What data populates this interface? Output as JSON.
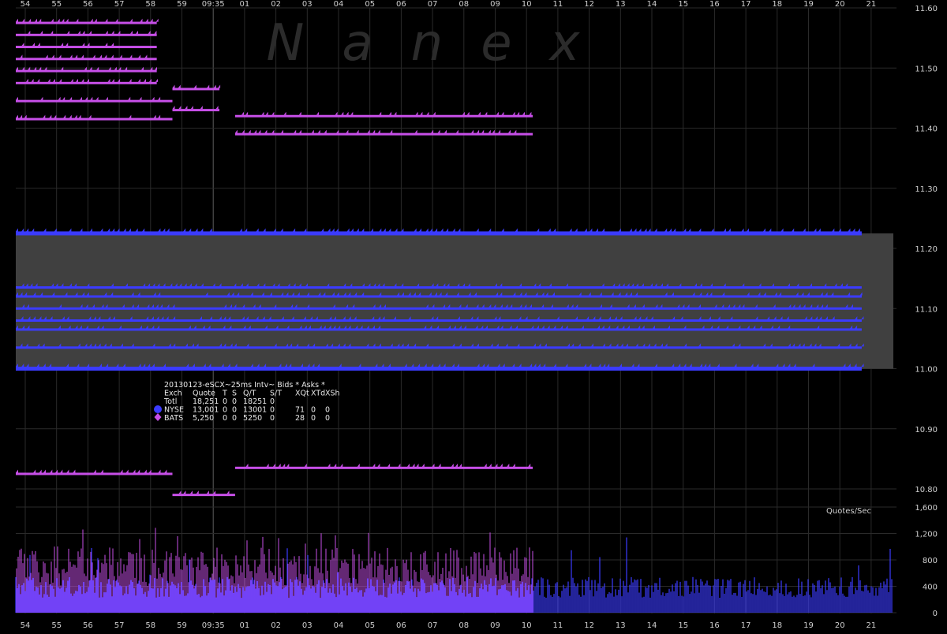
{
  "watermark": "Nanex",
  "x_axis": {
    "ticks": [
      "54",
      "55",
      "56",
      "57",
      "58",
      "59",
      "09:35",
      "01",
      "02",
      "03",
      "04",
      "05",
      "06",
      "07",
      "08",
      "09",
      "10",
      "11",
      "12",
      "13",
      "14",
      "15",
      "16",
      "17",
      "18",
      "19",
      "20",
      "21"
    ]
  },
  "price_axis": {
    "ticks": [
      "11.60",
      "11.50",
      "11.40",
      "11.30",
      "11.20",
      "11.10",
      "11.00",
      "10.90",
      "10.80"
    ]
  },
  "rate_axis": {
    "ticks": [
      "1,600",
      "1,200",
      "800",
      "400",
      "0"
    ],
    "label": "Quotes/Sec"
  },
  "legend": {
    "title": "20130123-eSCX~25ms Intv~ Bids * Asks *",
    "header": [
      "Exch",
      "Quote",
      "T",
      "S",
      "Q/T",
      "S/T",
      "XQt",
      "XTd",
      "XSh"
    ],
    "rows": [
      {
        "exch": "Totl",
        "quote": "18,251",
        "t": "0",
        "s": "0",
        "qt": "18251",
        "st": "0",
        "xqt": "",
        "xtd": "",
        "xsh": ""
      },
      {
        "exch": "NYSE",
        "quote": "13,001",
        "t": "0",
        "s": "0",
        "qt": "13001",
        "st": "0",
        "xqt": "71",
        "xtd": "0",
        "xsh": "0",
        "marker": "circle",
        "color": "#3b3bff"
      },
      {
        "exch": "BATS",
        "quote": "5,250",
        "t": "0",
        "s": "0",
        "qt": "5250",
        "st": "0",
        "xqt": "28",
        "xtd": "0",
        "xsh": "0",
        "marker": "diamond",
        "color": "#c74fe8"
      }
    ]
  },
  "colors": {
    "background": "#000000",
    "grid": "#2a2a2a",
    "nyse": "#3b3bff",
    "bats": "#c74fe8",
    "spread_fill": "#404040",
    "axis_text": "#cfcfcf"
  },
  "chart_data": [
    {
      "type": "scatter",
      "title": "20130123-eSCX~25ms Intv~ Bids * Asks *",
      "xlabel": "",
      "ylabel": "",
      "x_ticks": [
        "54",
        "55",
        "56",
        "57",
        "58",
        "59",
        "09:35",
        "01",
        "02",
        "03",
        "04",
        "05",
        "06",
        "07",
        "08",
        "09",
        "10",
        "11",
        "12",
        "13",
        "14",
        "15",
        "16",
        "17",
        "18",
        "19",
        "20",
        "21"
      ],
      "ylim": [
        10.78,
        11.6
      ],
      "grid": true,
      "legend_position": "center-left",
      "series": [
        {
          "name": "NYSE",
          "levels": [
            {
              "price": 11.225,
              "x": [
                "54",
                "21"
              ]
            },
            {
              "price": 11.135,
              "x": [
                "54",
                "21"
              ]
            },
            {
              "price": 11.12,
              "x": [
                "54",
                "21"
              ]
            },
            {
              "price": 11.1,
              "x": [
                "54",
                "21"
              ]
            },
            {
              "price": 11.08,
              "x": [
                "54",
                "21"
              ]
            },
            {
              "price": 11.065,
              "x": [
                "54",
                "21"
              ]
            },
            {
              "price": 11.035,
              "x": [
                "54",
                "21"
              ]
            },
            {
              "price": 11.0,
              "x": [
                "54",
                "21"
              ]
            }
          ]
        },
        {
          "name": "BATS",
          "levels": [
            {
              "price": 11.575,
              "x": [
                "54",
                "58.5"
              ]
            },
            {
              "price": 11.555,
              "x": [
                "54",
                "58.5"
              ]
            },
            {
              "price": 11.535,
              "x": [
                "54",
                "58.5"
              ]
            },
            {
              "price": 11.515,
              "x": [
                "54",
                "58.5"
              ]
            },
            {
              "price": 11.495,
              "x": [
                "54",
                "58.5"
              ]
            },
            {
              "price": 11.475,
              "x": [
                "54",
                "58.5"
              ]
            },
            {
              "price": 11.445,
              "x": [
                "54",
                "59"
              ]
            },
            {
              "price": 11.415,
              "x": [
                "54",
                "59"
              ]
            },
            {
              "price": 11.465,
              "x": [
                "59",
                "09:35.5"
              ]
            },
            {
              "price": 11.43,
              "x": [
                "59",
                "09:35.5"
              ]
            },
            {
              "price": 11.42,
              "x": [
                "01",
                "10.5"
              ]
            },
            {
              "price": 11.39,
              "x": [
                "01",
                "10.5"
              ]
            },
            {
              "price": 10.825,
              "x": [
                "54",
                "59"
              ]
            },
            {
              "price": 10.79,
              "x": [
                "59",
                "01"
              ]
            },
            {
              "price": 10.835,
              "x": [
                "01",
                "10.5"
              ]
            }
          ]
        }
      ]
    },
    {
      "type": "bar",
      "title": "",
      "ylabel": "Quotes/Sec",
      "ylim": [
        0,
        1600
      ],
      "x_ticks": [
        "54",
        "55",
        "56",
        "57",
        "58",
        "59",
        "09:35",
        "01",
        "02",
        "03",
        "04",
        "05",
        "06",
        "07",
        "08",
        "09",
        "10",
        "11",
        "12",
        "13",
        "14",
        "15",
        "16",
        "17",
        "18",
        "19",
        "20",
        "21"
      ],
      "series": [
        {
          "name": "NYSE",
          "typical": 450,
          "peak": 700
        },
        {
          "name": "BATS",
          "typical": 900,
          "peak": 1450,
          "x_end": "10.5"
        }
      ]
    }
  ]
}
